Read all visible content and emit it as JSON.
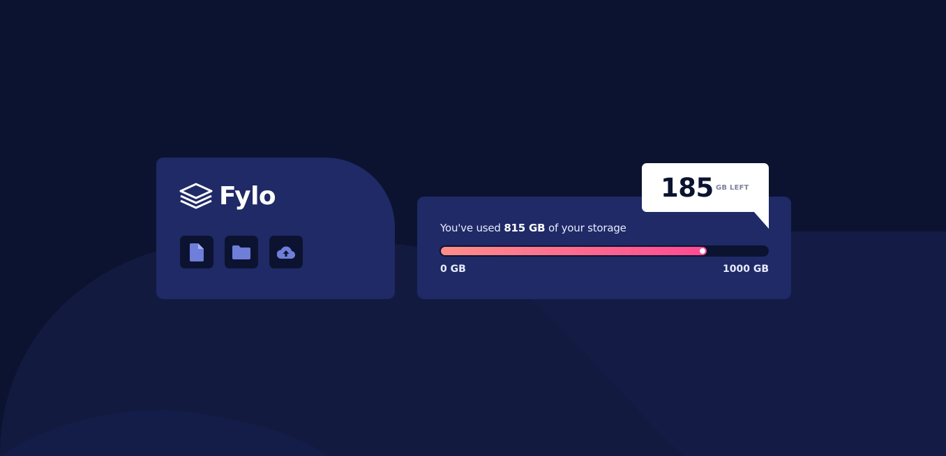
{
  "brand": {
    "logo_name": "layers-logo-icon",
    "name": "Fylo"
  },
  "actions": [
    {
      "icon": "document-icon",
      "color": "#6f7ed8"
    },
    {
      "icon": "folder-icon",
      "color": "#6f7ed8"
    },
    {
      "icon": "cloud-upload-icon",
      "color": "#6f7ed8"
    }
  ],
  "storage": {
    "usage_prefix": "You've used",
    "used_amount": "815 GB",
    "usage_suffix": "of your storage",
    "min_label": "0 GB",
    "max_label": "1000 GB",
    "used_value": 815,
    "max_value": 1000
  },
  "callout": {
    "remaining": "185",
    "unit": "GB LEFT"
  },
  "colors": {
    "background": "#0c1330",
    "card": "#1f2a66",
    "gradient_start": "#fd8e8a",
    "gradient_end": "#ff4994",
    "icon": "#6f7ed8"
  }
}
